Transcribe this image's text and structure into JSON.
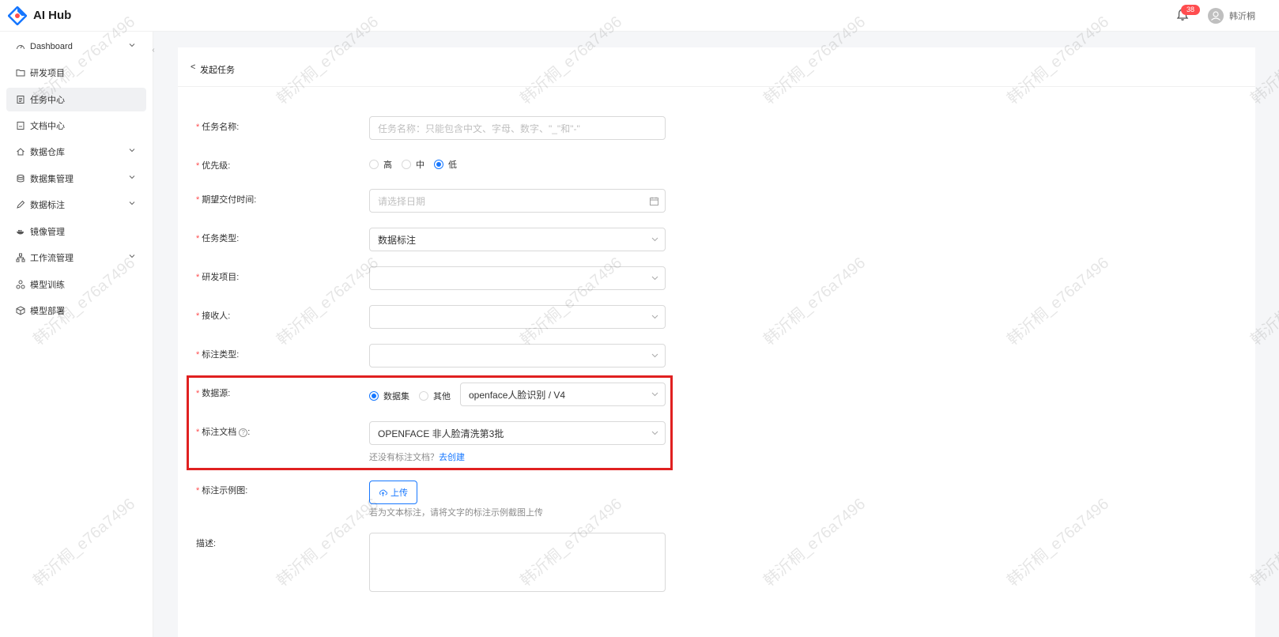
{
  "app": {
    "brand": "AI Hub",
    "notification_count": "38",
    "user_name": "韩沂桐"
  },
  "sidebar": {
    "items": [
      {
        "label": "Dashboard",
        "icon": "dashboard-icon",
        "expandable": true
      },
      {
        "label": "研发项目",
        "icon": "folder-icon",
        "expandable": false
      },
      {
        "label": "任务中心",
        "icon": "task-icon",
        "expandable": false,
        "active": true
      },
      {
        "label": "文档中心",
        "icon": "document-icon",
        "expandable": false
      },
      {
        "label": "数据仓库",
        "icon": "home-icon",
        "expandable": true
      },
      {
        "label": "数据集管理",
        "icon": "database-icon",
        "expandable": true
      },
      {
        "label": "数据标注",
        "icon": "edit-icon",
        "expandable": true
      },
      {
        "label": "镜像管理",
        "icon": "docker-icon",
        "expandable": false
      },
      {
        "label": "工作流管理",
        "icon": "workflow-icon",
        "expandable": true
      },
      {
        "label": "模型训练",
        "icon": "model-train-icon",
        "expandable": false
      },
      {
        "label": "模型部署",
        "icon": "model-deploy-icon",
        "expandable": false
      }
    ]
  },
  "page": {
    "title": "发起任务",
    "back_label": "<"
  },
  "form": {
    "task_name": {
      "label": "任务名称:",
      "placeholder": "任务名称：只能包含中文、字母、数字、\"_\"和\"-\""
    },
    "priority": {
      "label": "优先级:",
      "options": [
        "高",
        "中",
        "低"
      ],
      "selected": "低"
    },
    "due_time": {
      "label": "期望交付时间:",
      "placeholder": "请选择日期"
    },
    "task_type": {
      "label": "任务类型:",
      "value": "数据标注"
    },
    "project": {
      "label": "研发项目:",
      "value": ""
    },
    "receiver": {
      "label": "接收人:",
      "value": ""
    },
    "annotation_type": {
      "label": "标注类型:",
      "value": ""
    },
    "data_source": {
      "label": "数据源:",
      "options": [
        "数据集",
        "其他"
      ],
      "selected": "数据集",
      "value": "openface人脸识别 / V4"
    },
    "annotation_doc": {
      "label": "标注文档",
      "label_suffix": ":",
      "value": "OPENFACE 非人脸清洗第3批",
      "hint": "还没有标注文档？",
      "hint_link": "去创建"
    },
    "example_image": {
      "label": "标注示例图:",
      "upload_label": "上传",
      "hint": "若为文本标注，请将文字的标注示例截图上传"
    },
    "description": {
      "label": "描述:"
    }
  },
  "watermark": {
    "text": "韩沂桐_e76a7496"
  },
  "colors": {
    "primary": "#1677ff",
    "required": "#ff4d4f",
    "highlight": "#e02020",
    "badge": "#ff4d4f"
  }
}
